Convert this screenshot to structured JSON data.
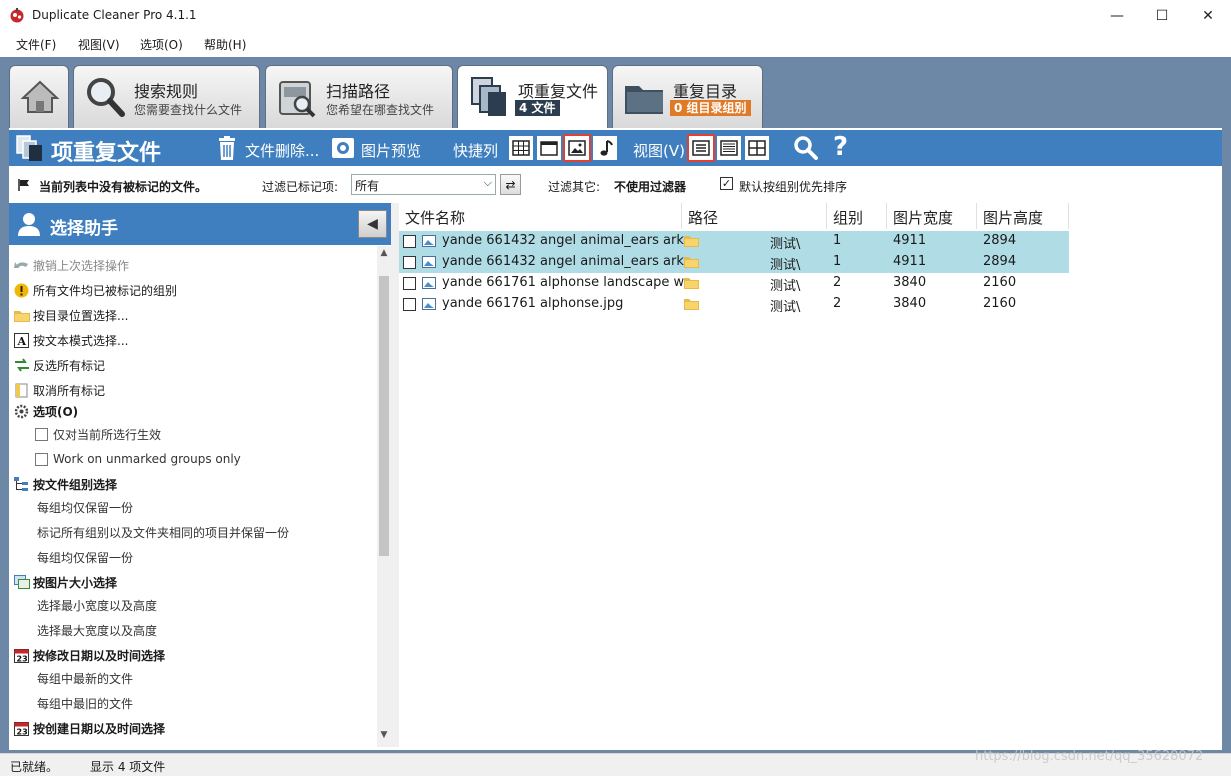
{
  "window": {
    "title": "Duplicate Cleaner Pro 4.1.1",
    "min": "—",
    "max": "☐",
    "close": "✕"
  },
  "menu": [
    {
      "label": "文件(F)"
    },
    {
      "label": "视图(V)"
    },
    {
      "label": "选项(O)"
    },
    {
      "label": "帮助(H)"
    }
  ],
  "tabs": {
    "rules": {
      "title": "搜索规则",
      "subtitle": "您需要查找什么文件"
    },
    "paths": {
      "title": "扫描路径",
      "subtitle": "您希望在哪查找文件"
    },
    "files": {
      "title": "项重复文件",
      "badge": "4 文件"
    },
    "dirs": {
      "title": "重复目录",
      "badge": "0 组目录组别"
    }
  },
  "toolbar": {
    "title": "项重复文件",
    "delete_label": "文件删除...",
    "preview_label": "图片预览",
    "shortcut_label": "快捷列",
    "view_label": "视图(V)",
    "help": "?"
  },
  "filter": {
    "no_marked": "当前列表中没有被标记的文件。",
    "filter_label": "过滤已标记项:",
    "filter_value": "所有",
    "other_label": "过滤其它:",
    "other_value": "不使用过滤器",
    "sort_checked": "✓",
    "sort_label": "默认按组别优先排序"
  },
  "assistant": {
    "title": "选择助手",
    "collapse": "◀",
    "items": [
      {
        "label": "撤销上次选择操作"
      },
      {
        "label": "所有文件均已被标记的组别"
      },
      {
        "label": "按目录位置选择..."
      },
      {
        "label": "按文本模式选择..."
      },
      {
        "label": "反选所有标记"
      },
      {
        "label": "取消所有标记"
      },
      {
        "label": "选项(O)"
      },
      {
        "label": "仅对当前所选行生效"
      },
      {
        "label": "Work on unmarked groups only"
      },
      {
        "label": "按文件组别选择"
      },
      {
        "label": "每组均仅保留一份"
      },
      {
        "label": "标记所有组别以及文件夹相同的项目并保留一份"
      },
      {
        "label": "每组均仅保留一份"
      },
      {
        "label": "按图片大小选择"
      },
      {
        "label": "选择最小宽度以及高度"
      },
      {
        "label": "选择最大宽度以及高度"
      },
      {
        "label": "按修改日期以及时间选择"
      },
      {
        "label": "每组中最新的文件"
      },
      {
        "label": "每组中最旧的文件"
      },
      {
        "label": "按创建日期以及时间选择"
      }
    ],
    "scroll_up": "▲",
    "scroll_down": "▼"
  },
  "grid": {
    "columns": [
      "文件名称",
      "路径",
      "组别",
      "图片宽度",
      "图片高度"
    ],
    "rows": [
      {
        "name": "yande 661432 angel animal_ears ark...",
        "path": "测试\\",
        "group": "1",
        "width": "4911",
        "height": "2894",
        "selected": true
      },
      {
        "name": "yande 661432 angel animal_ears ark...",
        "path": "测试\\",
        "group": "1",
        "width": "4911",
        "height": "2894",
        "selected": true
      },
      {
        "name": "yande 661761 alphonse landscape w...",
        "path": "测试\\",
        "group": "2",
        "width": "3840",
        "height": "2160",
        "selected": false
      },
      {
        "name": "yande 661761 alphonse.jpg",
        "path": "测试\\",
        "group": "2",
        "width": "3840",
        "height": "2160",
        "selected": false
      }
    ]
  },
  "status": {
    "ready": "已就绪。",
    "count": "显示 4 项文件"
  },
  "watermark": "https://blog.csdn.net/qq_35628072",
  "colors": {
    "accent": "#3f7fbf",
    "frame": "#6d87a6",
    "selected_row": "#b0dce6",
    "highlight": "#e0402f"
  }
}
